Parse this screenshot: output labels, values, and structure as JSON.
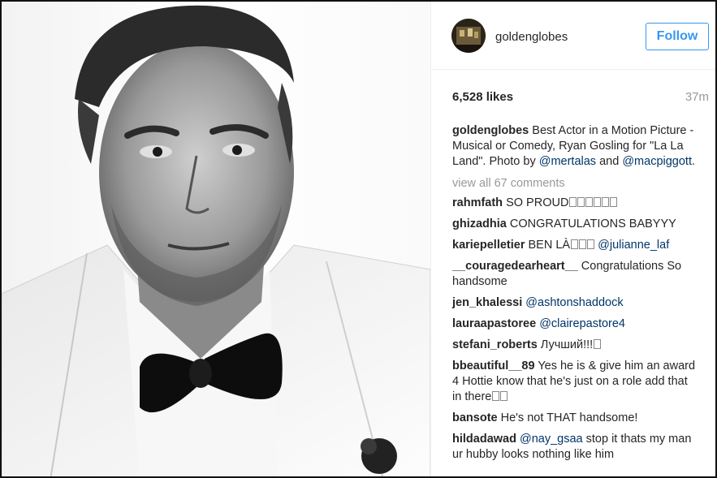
{
  "post": {
    "username": "goldenglobes",
    "follow_label": "Follow",
    "likes": "6,528 likes",
    "time": "37m",
    "caption": {
      "username": "goldenglobes",
      "text": "Best Actor in a Motion Picture - Musical or Comedy, Ryan Gosling for \"La La Land\". Photo by",
      "mention1": "@mertalas",
      "and": "and",
      "mention2": "@macpiggott",
      "end": "."
    },
    "view_all": "view all 67 comments"
  },
  "comments": [
    {
      "user": "rahmfath",
      "text": "SO PROUD",
      "boxes": 6,
      "mention": ""
    },
    {
      "user": "ghizadhia",
      "text": "CONGRATULATIONS BABYYY",
      "boxes": 0,
      "mention": ""
    },
    {
      "user": "kariepelletier",
      "text": "BEN LÀ",
      "boxes": 3,
      "mention": "@julianne_laf"
    },
    {
      "user": "__couragedearheart__",
      "text": "Congratulations So handsome",
      "boxes": 0,
      "mention": ""
    },
    {
      "user": "jen_khalessi",
      "text": "",
      "boxes": 0,
      "mention": "@ashtonshaddock"
    },
    {
      "user": "lauraapastoree",
      "text": "",
      "boxes": 0,
      "mention": "@clairepastore4"
    },
    {
      "user": "stefani_roberts",
      "text": "Лучший!!!",
      "boxes": 1,
      "mention": ""
    },
    {
      "user": "bbeautiful__89",
      "text": "Yes he is & give him an award 4 Hottie know that he's just on a role add that in there",
      "boxes": 2,
      "mention": ""
    },
    {
      "user": "bansote",
      "text": "He's not THAT handsome!",
      "boxes": 0,
      "mention": ""
    },
    {
      "user": "hildadawad",
      "text": "stop it thats my man ur hubby looks nothing like him",
      "boxes": 0,
      "mention": "@nay_gsaa",
      "mention_first": true
    }
  ]
}
